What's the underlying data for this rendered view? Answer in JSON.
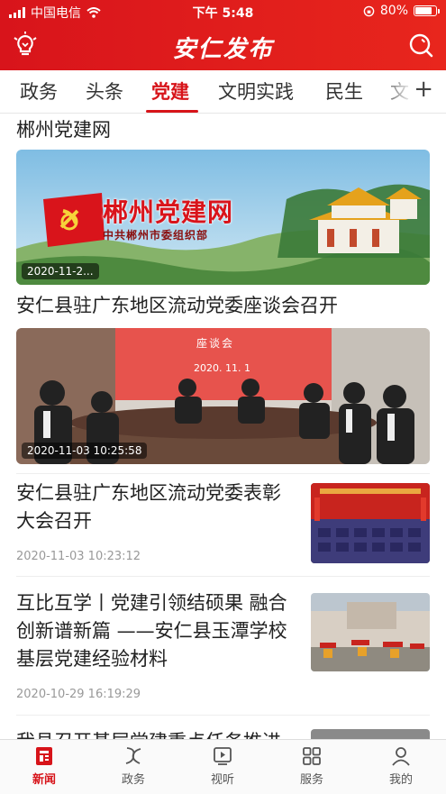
{
  "status_bar": {
    "carrier": "中国电信",
    "time": "下午 5:48",
    "battery": "80%",
    "battery_level": 0.8
  },
  "header": {
    "title": "安仁发布",
    "left_icon": "lightbulb-icon",
    "right_icon": "search-icon"
  },
  "tabs": {
    "items": [
      "政务",
      "头条",
      "党建",
      "文明实践",
      "民生",
      "文"
    ],
    "active": "党建",
    "more_label": "+"
  },
  "feed": {
    "section_title": "郴州党建网",
    "hero1": {
      "timestamp": "2020-11-2...",
      "banner_title": "郴州党建网",
      "banner_subtitle": "中共郴州市委组织部"
    },
    "article1": {
      "title": "安仁县驻广东地区流动党委座谈会召开",
      "timestamp": "2020-11-03 10:25:58",
      "screen_text": "座谈会",
      "screen_date": "2020. 11. 1"
    },
    "article2": {
      "title": "安仁县驻广东地区流动党委表彰大会召开",
      "date": "2020-11-03 10:23:12"
    },
    "article3": {
      "title": "互比互学丨党建引领结硕果 融合创新谱新篇 ——安仁县玉潭学校基层党建经验材料",
      "date": "2020-10-29 16:19:29"
    },
    "article4": {
      "title": "我县召开基层党建重点任务推进"
    }
  },
  "bottom_nav": {
    "items": [
      {
        "label": "新闻",
        "icon": "news-icon"
      },
      {
        "label": "政务",
        "icon": "government-icon"
      },
      {
        "label": "视听",
        "icon": "video-icon"
      },
      {
        "label": "服务",
        "icon": "services-grid-icon"
      },
      {
        "label": "我的",
        "icon": "profile-icon"
      }
    ],
    "active": "新闻"
  },
  "colors": {
    "brand_red": "#d7141a",
    "header_gradient_start": "#d8141b",
    "header_gradient_end": "#e8261d"
  }
}
